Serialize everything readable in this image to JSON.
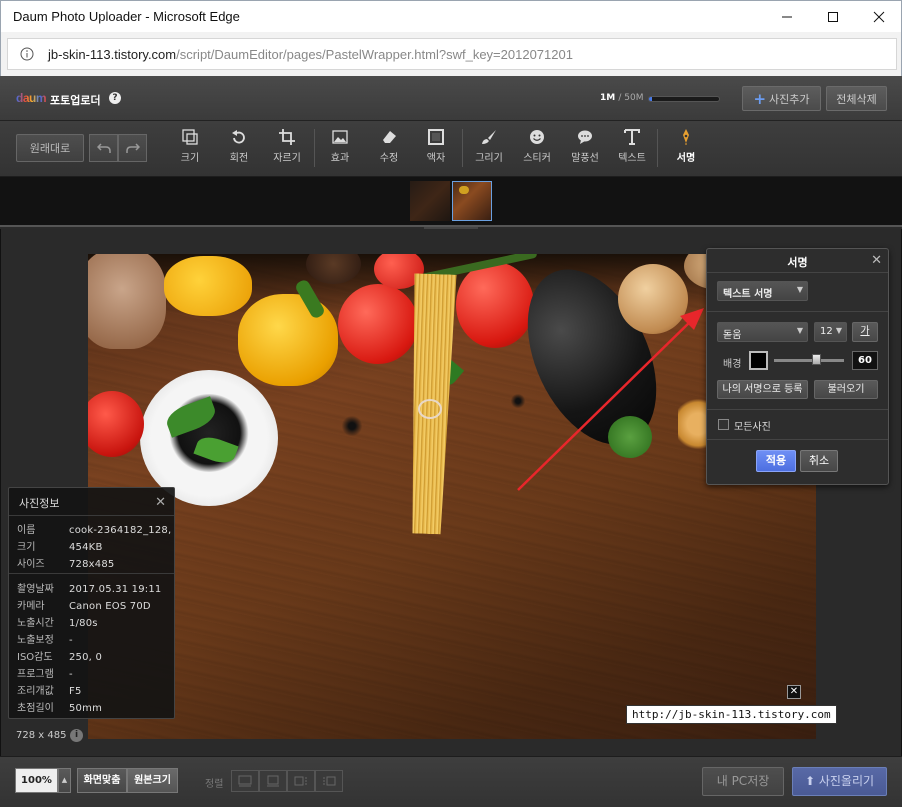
{
  "window": {
    "title": "Daum Photo Uploader - Microsoft Edge",
    "url_host": "jb-skin-113.tistory.com",
    "url_path": "/script/DaumEditor/pages/PastelWrapper.html?swf_key=2012071201"
  },
  "header": {
    "logo": "daum",
    "title": "포토업로더",
    "help": "?",
    "quota_used": "1M",
    "quota_max": "/ 50M",
    "quota_fraction": 0.04,
    "add_photo": "사진추가",
    "delete_all": "전체삭제"
  },
  "toolbar": {
    "original": "원래대로",
    "tools": [
      {
        "label": "크기",
        "icon": "resize-icon"
      },
      {
        "label": "회전",
        "icon": "rotate-icon"
      },
      {
        "label": "자르기",
        "icon": "crop-icon"
      },
      {
        "label": "효과",
        "icon": "effect-icon"
      },
      {
        "label": "수정",
        "icon": "eraser-icon"
      },
      {
        "label": "액자",
        "icon": "frame-icon"
      },
      {
        "label": "그리기",
        "icon": "brush-icon"
      },
      {
        "label": "스티커",
        "icon": "sticker-icon"
      },
      {
        "label": "말풍선",
        "icon": "speech-bubble-icon"
      },
      {
        "label": "텍스트",
        "icon": "text-icon"
      },
      {
        "label": "서명",
        "icon": "signature-icon"
      }
    ]
  },
  "photo": {
    "signature_text": "http://jb-skin-113.tistory.com",
    "dimensions": "728 x 485"
  },
  "info_panel": {
    "title": "사진정보",
    "rows_top": [
      {
        "k": "이름",
        "v": "cook-2364182_128,"
      },
      {
        "k": "크기",
        "v": "454KB"
      },
      {
        "k": "사이즈",
        "v": "728x485"
      }
    ],
    "rows_bottom": [
      {
        "k": "촬영날짜",
        "v": "2017.05.31 19:11"
      },
      {
        "k": "카메라",
        "v": "Canon EOS 70D"
      },
      {
        "k": "노출시간",
        "v": "1/80s"
      },
      {
        "k": "노출보정",
        "v": "-"
      },
      {
        "k": "ISO감도",
        "v": "250, 0"
      },
      {
        "k": "프로그램",
        "v": "-"
      },
      {
        "k": "조리개값",
        "v": "F5"
      },
      {
        "k": "초점길이",
        "v": "50mm"
      }
    ]
  },
  "signature_panel": {
    "title": "서명",
    "type_select": "텍스트 서명",
    "font_select": "돋움",
    "size_select": "12",
    "font_style_btn": "가",
    "bg_label": "배경",
    "bg_color": "#000000",
    "opacity_value": "60",
    "opacity_fraction": 0.6,
    "register_btn": "나의 서명으로 등록",
    "load_btn": "불러오기",
    "all_photos": "모든사진",
    "apply": "적용",
    "cancel": "취소"
  },
  "bottom": {
    "zoom": "100%",
    "fit": "화면맞춤",
    "original_size": "원본크기",
    "align_label": "정렬",
    "pc_save": "내 PC저장",
    "upload": "사진올리기"
  },
  "colors": {
    "accent": "#4d6fe0",
    "arrow": "#e8262b",
    "panel_bg": "#2d2d2d"
  }
}
